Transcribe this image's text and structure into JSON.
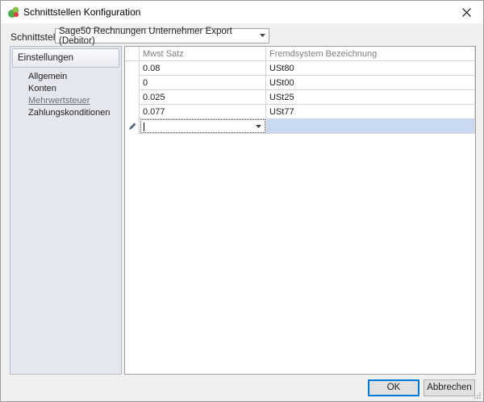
{
  "window": {
    "title": "Schnittstellen Konfiguration"
  },
  "interface": {
    "label": "Schnittstelle",
    "selected": "Sage50 Rechnungen Unternehmer Export (Debitor)"
  },
  "sidebar": {
    "header": "Einstellungen",
    "items": [
      {
        "label": "Allgemein"
      },
      {
        "label": "Konten"
      },
      {
        "label": "Mehrwertsteuer"
      },
      {
        "label": "Zahlungskonditionen"
      }
    ],
    "active_index": 2
  },
  "grid": {
    "columns": [
      "Mwst Satz",
      "Fremdsystem Bezeichnung"
    ],
    "rows": [
      [
        "0.08",
        "USt80"
      ],
      [
        "0",
        "USt00"
      ],
      [
        "0.025",
        "USt25"
      ],
      [
        "0.077",
        "USt77"
      ]
    ],
    "new_row": [
      "",
      ""
    ]
  },
  "buttons": {
    "ok": "OK",
    "cancel": "Abbrechen"
  },
  "colors": {
    "accent": "#0078d7",
    "new_row_highlight": "#c9d9f1",
    "sidebar_bg": "#e4e8ee"
  }
}
